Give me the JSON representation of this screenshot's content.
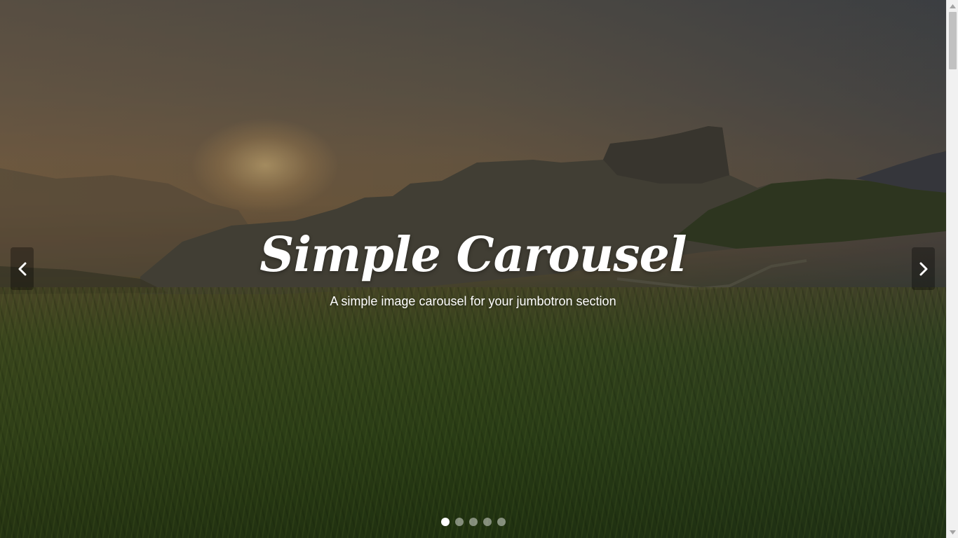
{
  "carousel": {
    "title": "Simple Carousel",
    "subtitle": "A simple image carousel for your jumbotron section",
    "prev_icon": "chevron-left-icon",
    "next_icon": "chevron-right-icon",
    "slide_count": 5,
    "active_index": 0,
    "indicators": [
      "1",
      "2",
      "3",
      "4",
      "5"
    ]
  },
  "colors": {
    "text": "#ffffff",
    "indicator_active": "#ffffff",
    "indicator_inactive": "rgba(255,255,255,0.45)",
    "arrow_bg": "rgba(0,0,0,0.32)"
  },
  "scrollbar": {
    "up_icon": "triangle-up-icon",
    "down_icon": "triangle-down-icon"
  }
}
